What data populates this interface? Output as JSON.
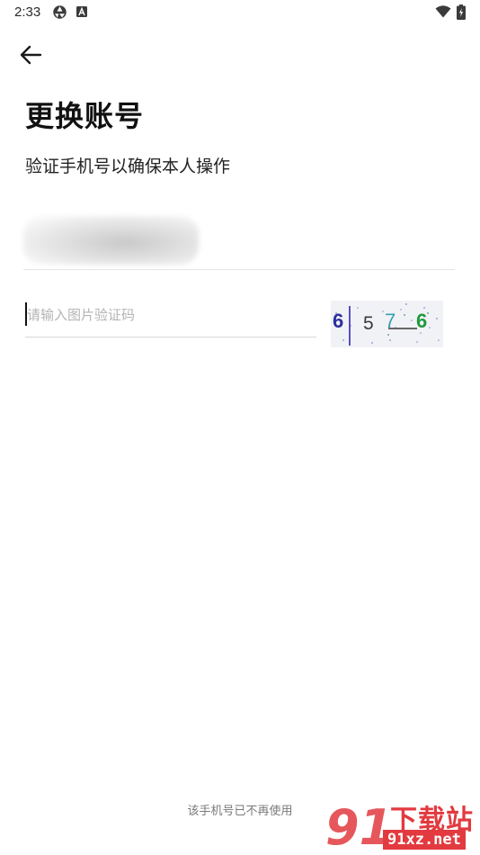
{
  "status_bar": {
    "time": "2:33",
    "icons": [
      "aperture-icon",
      "a-square-icon",
      "wifi-icon",
      "battery-charging-icon"
    ]
  },
  "header": {
    "back_icon": "arrow-left-icon"
  },
  "main": {
    "title": "更换账号",
    "subtitle": "验证手机号以确保本人操作",
    "phone_field": {
      "value_obscured": true
    },
    "captcha": {
      "placeholder": "请输入图片验证码",
      "value": "",
      "image_text": "6 5 7 6",
      "image_colors": [
        "#2b2f9e",
        "#3a3a3a",
        "#35a0b0",
        "#1f9a3c"
      ]
    }
  },
  "footer": {
    "not_in_use_label": "该手机号已不再使用"
  },
  "watermark": {
    "logo_glyph": "91",
    "name": "下载站",
    "url": "91xz.net",
    "color": "#e23a3f"
  }
}
